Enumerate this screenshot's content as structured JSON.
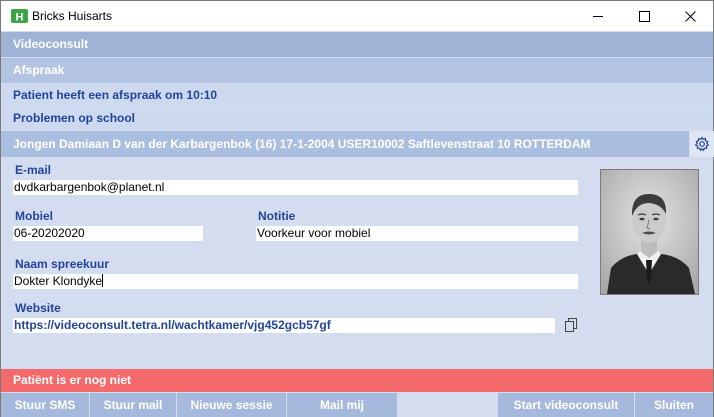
{
  "window": {
    "title": "Bricks Huisarts",
    "logo": "H",
    "controls": [
      "minimize-icon",
      "maximize-icon",
      "close-icon"
    ]
  },
  "header": {
    "videoconsult": "Videoconsult",
    "afspraak": "Afspraak",
    "appointment_info": "Patient heeft een afspraak om 10:10",
    "reason": "Problemen op school",
    "patient_line": "Jongen Damiaan D van der Karbargenbok (16) 17-1-2004 USER10002 Saftlevenstraat 10  ROTTERDAM"
  },
  "form": {
    "email_label": "E-mail",
    "email_value": "dvdkarbargenbok@planet.nl",
    "mobiel_label": "Mobiel",
    "mobiel_value": "06-20202020",
    "notitie_label": "Notitie",
    "notitie_value": "Voorkeur voor mobiel",
    "spreekuur_label": "Naam spreekuur",
    "spreekuur_value": "Dokter Klondyke",
    "website_label": "Website",
    "website_value": "https://videoconsult.tetra.nl/wachtkamer/vjg452gcb57gf"
  },
  "status": {
    "text": "Patiënt is er nog niet",
    "color": "#f46a6a"
  },
  "buttons": {
    "stuur_sms": "Stuur SMS",
    "stuur_mail": "Stuur mail",
    "nieuwe_sessie": "Nieuwe sessie",
    "mail_mij": "Mail mij",
    "start_videoconsult": "Start videoconsult",
    "sluiten": "Sluiten"
  },
  "colors": {
    "accent_text": "#23449a",
    "header_bar": "#9eb3d6",
    "panel": "#d4ddf0",
    "button": "#a5b9dc"
  }
}
